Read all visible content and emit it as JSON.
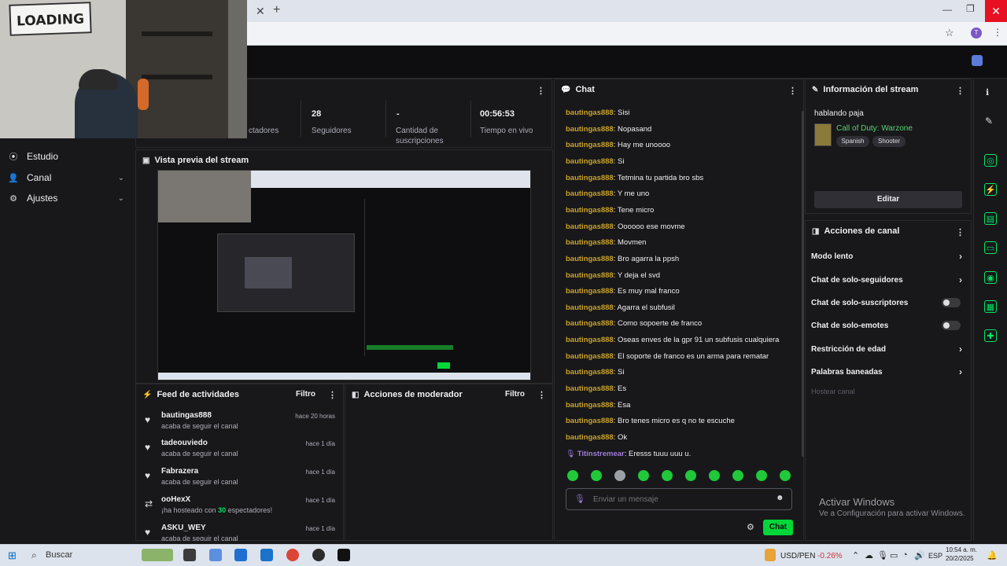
{
  "webcam": {
    "sign_text": "LOADING"
  },
  "sidebar": {
    "items": [
      {
        "label": "Estudio",
        "icon": "studio-icon"
      },
      {
        "label": "Canal",
        "icon": "user-icon"
      },
      {
        "label": "Ajustes",
        "icon": "gear-icon"
      }
    ]
  },
  "stats": [
    {
      "value": "",
      "label": "ctadores"
    },
    {
      "value": "28",
      "label": "Seguidores"
    },
    {
      "value": "-",
      "label": "Cantidad de suscripciones"
    },
    {
      "value": "00:56:53",
      "label": "Tiempo en vivo"
    }
  ],
  "preview": {
    "title": "Vista previa del stream"
  },
  "feed": {
    "title": "Feed de actividades",
    "filter_label": "Filtro",
    "items": [
      {
        "name": "bautingas888",
        "sub": "acaba de seguir el canal",
        "time": "hace 20 horas",
        "icon": "heart-icon"
      },
      {
        "name": "tadeouviedo",
        "sub": "acaba de seguir el canal",
        "time": "hace 1 día",
        "icon": "heart-icon"
      },
      {
        "name": "Fabrazera",
        "sub": "acaba de seguir el canal",
        "time": "hace 1 día",
        "icon": "heart-icon"
      },
      {
        "name": "ooHexX",
        "sub_pre": "¡ha hosteado con ",
        "sub_num": "30",
        "sub_post": " espectadores!",
        "time": "hace 1 día",
        "icon": "host-icon"
      },
      {
        "name": "ASKU_WEY",
        "sub": "acaba de seguir el canal",
        "time": "hace 1 día",
        "icon": "heart-icon"
      }
    ]
  },
  "moderator": {
    "title": "Acciones de moderador",
    "filter_label": "Filtro"
  },
  "chat": {
    "title": "Chat",
    "messages": [
      {
        "user": "bautingas888",
        "text": " Sisi"
      },
      {
        "user": "bautingas888",
        "text": " Nopasand"
      },
      {
        "user": "bautingas888",
        "text": " Hay me unoooo"
      },
      {
        "user": "bautingas888",
        "text": " Si"
      },
      {
        "user": "bautingas888",
        "text": " Tetmina tu partida bro sbs"
      },
      {
        "user": "bautingas888",
        "text": " Y me uno"
      },
      {
        "user": "bautingas888",
        "text": " Tene micro"
      },
      {
        "user": "bautingas888",
        "text": " Oooooo ese movme"
      },
      {
        "user": "bautingas888",
        "text": " Movmen"
      },
      {
        "user": "bautingas888",
        "text": " Bro agarra la ppsh"
      },
      {
        "user": "bautingas888",
        "text": " Y deja el svd"
      },
      {
        "user": "bautingas888",
        "text": " Es muy mal franco"
      },
      {
        "user": "bautingas888",
        "text": " Agarra el subfusil"
      },
      {
        "user": "bautingas888",
        "text": " Como sopoerte de franco"
      },
      {
        "user": "bautingas888",
        "text": " Oseas enves de la gpr 91 un subfusis cualquiera"
      },
      {
        "user": "bautingas888",
        "text": " El soporte de franco es un arma para rematar"
      },
      {
        "user": "bautingas888",
        "text": " Si"
      },
      {
        "user": "bautingas888",
        "text": " Es"
      },
      {
        "user": "bautingas888",
        "text": " Esa"
      },
      {
        "user": "bautingas888",
        "text": " Bro tenes micro es q no te escuche"
      },
      {
        "user": "bautingas888",
        "text": " Ok"
      }
    ],
    "streamer_message": {
      "user": "Titinstremear",
      "text": " Eresss tuuu uuu u."
    },
    "input_placeholder": "Enviar un mensaje",
    "send_label": "Chat"
  },
  "stream_info": {
    "title": "Información del stream",
    "stream_title": "hablando paja",
    "category": "Call of Duty: Warzone",
    "tags": [
      "Spanish",
      "Shooter"
    ],
    "edit_label": "Editar"
  },
  "channel_actions": {
    "title": "Acciones de canal",
    "items": [
      {
        "label": "Modo lento",
        "control": "chevron"
      },
      {
        "label": "Chat de solo-seguidores",
        "control": "chevron"
      },
      {
        "label": "Chat de solo-suscriptores",
        "control": "toggle"
      },
      {
        "label": "Chat de solo-emotes",
        "control": "toggle"
      },
      {
        "label": "Restricción de edad",
        "control": "chevron"
      },
      {
        "label": "Palabras baneadas",
        "control": "chevron"
      }
    ],
    "host_label": "Hostear canal"
  },
  "activate_windows": {
    "title": "Activar Windows",
    "sub": "Ve a Configuración para activar Windows."
  },
  "taskbar": {
    "search_label": "Buscar",
    "ticker_label": "USD/PEN",
    "ticker_value": "-0.26%",
    "lang": "ESP",
    "time": "10:54 a. m.",
    "date": "20/2/2025"
  },
  "colors": {
    "accent": "#00e564",
    "chat_user": "#c9a227",
    "streamer": "#9d7bd8",
    "background": "#18181b"
  }
}
